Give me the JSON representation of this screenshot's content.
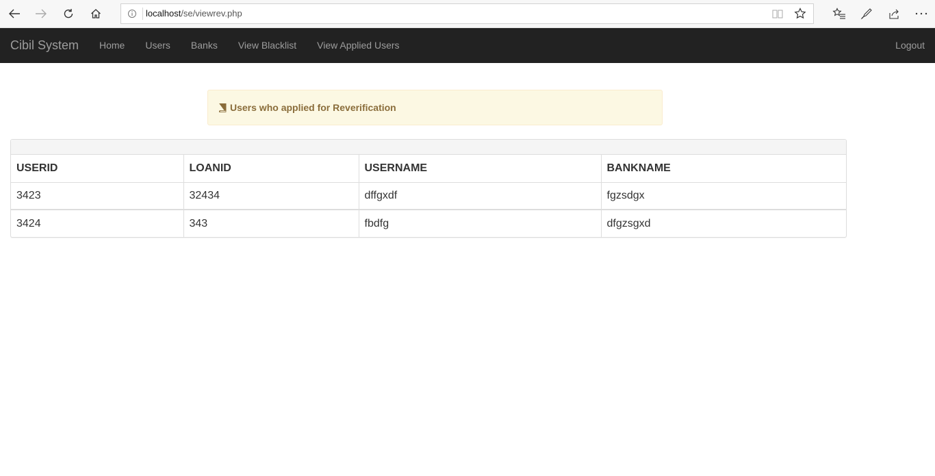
{
  "browser": {
    "url_host": "localhost",
    "url_path": "/se/viewrev.php"
  },
  "navbar": {
    "brand": "Cibil System",
    "links": [
      {
        "label": "Home"
      },
      {
        "label": "Users"
      },
      {
        "label": "Banks"
      },
      {
        "label": "View Blacklist"
      },
      {
        "label": "View Applied Users"
      }
    ],
    "logout_label": "Logout",
    "background_color": "#222222",
    "link_color": "#9d9d9d"
  },
  "alert": {
    "icon": "book-icon",
    "text": "Users who applied for Reverification",
    "background_color": "#fcf8e3",
    "text_color": "#8a6d3b"
  },
  "table": {
    "columns": [
      "USERID",
      "LOANID",
      "USERNAME",
      "BANKNAME"
    ],
    "rows": [
      [
        "3423",
        "32434",
        "dffgxdf",
        "fgzsdgx"
      ],
      [
        "3424",
        "343",
        "fbdfg",
        "dfgzsgxd"
      ]
    ]
  }
}
